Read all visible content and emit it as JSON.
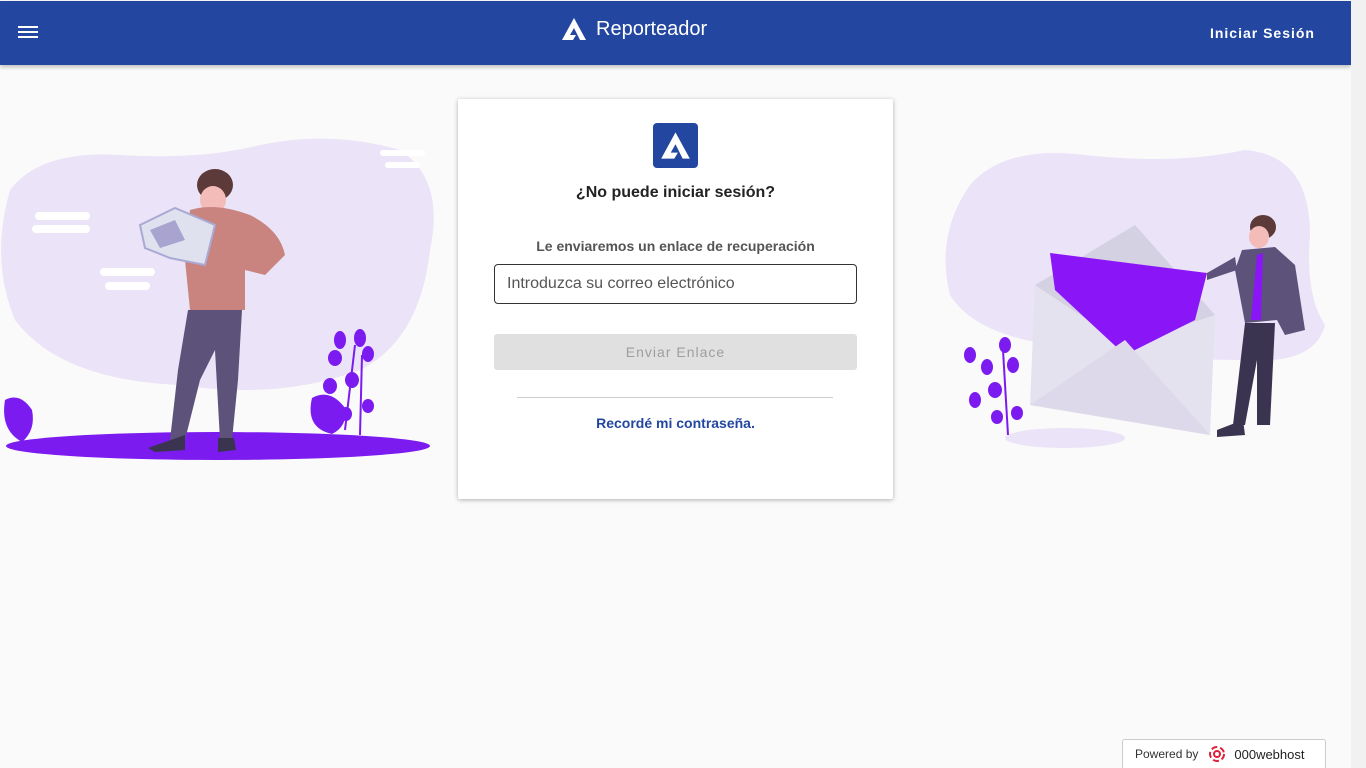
{
  "header": {
    "app_title": "Reporteador",
    "login_label": "Iniciar Sesión",
    "bar_color": "#2347a0"
  },
  "card": {
    "title": "¿No puede iniciar sesión?",
    "subtitle": "Le enviaremos un enlace de recuperación",
    "email_placeholder": "Introduzca su correo electrónico",
    "email_value": "",
    "send_label": "Enviar Enlace",
    "remember_label": "Recordé mi contraseña."
  },
  "footer": {
    "powered_label": "Powered by",
    "host_name": "000webhost"
  },
  "icons": {
    "menu": "menu-icon",
    "logo": "app-logo-icon"
  }
}
